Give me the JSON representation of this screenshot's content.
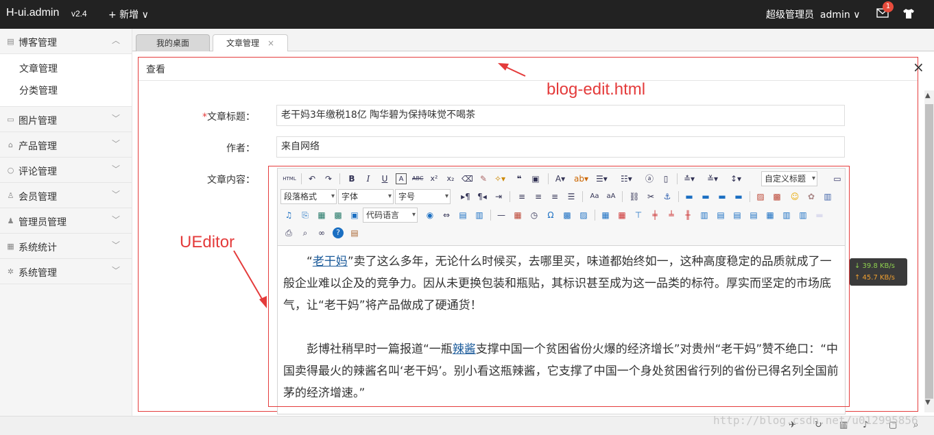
{
  "header": {
    "logo": "H-ui.admin",
    "version": "v2.4",
    "add_label": "+ 新增 ∨",
    "user_role": "超级管理员",
    "user_name": "admin ∨",
    "badge_count": "1"
  },
  "sidebar": {
    "groups": [
      {
        "label": "博客管理",
        "icon": "blog-icon",
        "expanded": true,
        "items": [
          "文章管理",
          "分类管理"
        ]
      },
      {
        "label": "图片管理",
        "icon": "picture-icon"
      },
      {
        "label": "产品管理",
        "icon": "product-icon"
      },
      {
        "label": "评论管理",
        "icon": "comment-icon"
      },
      {
        "label": "会员管理",
        "icon": "member-icon"
      },
      {
        "label": "管理员管理",
        "icon": "admin-icon"
      },
      {
        "label": "系统统计",
        "icon": "stats-icon"
      },
      {
        "label": "系统管理",
        "icon": "settings-icon"
      }
    ]
  },
  "tabs": [
    {
      "label": "我的桌面"
    },
    {
      "label": "文章管理",
      "close": "×"
    }
  ],
  "dialog": {
    "title": "查看",
    "close": "×"
  },
  "form": {
    "title_label": "文章标题：",
    "title_required": "*",
    "title_value": "老干妈3年缴税18亿 陶华碧为保持味觉不喝茶",
    "author_label": "作者：",
    "author_value": "来自网络",
    "content_label": "文章内容："
  },
  "editor": {
    "custom_heading": "自定义标题",
    "paragraph_format": "段落格式",
    "font_family": "字体",
    "font_size": "字号",
    "code_language": "代码语言",
    "paragraphs": [
      {
        "pre": "“",
        "link": "老干妈",
        "post": "”卖了这么多年，无论什么时候买，去哪里买，味道都始终如一，这种高度稳定的品质就成了一般企业难以企及的竞争力。因从未更换包装和瓶贴，其标识甚至成为这一品类的标符。厚实而坚定的市场底气，让“老干妈”将产品做成了硬通货！"
      },
      {
        "pre": "彭博社稍早时一篇报道“一瓶",
        "link": "辣酱",
        "post": "支撑中国一个贫困省份火爆的经济增长”对贵州“老干妈”赞不绝口：“中国卖得最火的辣酱名叫‘老干妈’。别小看这瓶辣酱，它支撑了中国一个身处贫困省行列的省份已得名列全国前茅的经济增速。”"
      }
    ]
  },
  "netspeed": {
    "down": "↓ 39.8 KB/s",
    "up": "↑ 45.7 KB/s"
  },
  "annotations": {
    "blog_edit": "blog-edit.html",
    "ueditor": "UEditor"
  },
  "watermark": "http://blog.csdn.net/u012995856"
}
